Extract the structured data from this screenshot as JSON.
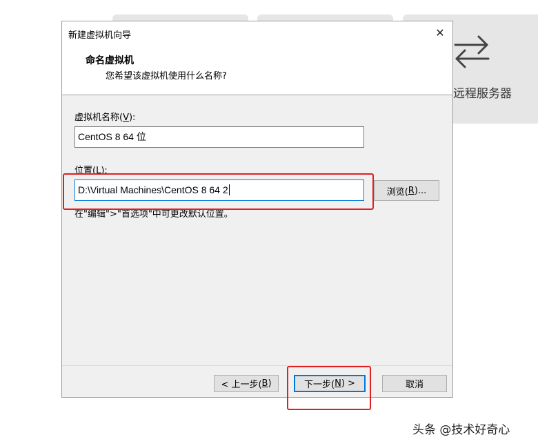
{
  "background": {
    "remote_label": "远程服务器"
  },
  "dialog": {
    "title": "新建虚拟机向导",
    "close_symbol": "✕",
    "heading": "命名虚拟机",
    "subheading": "您希望该虚拟机使用什么名称?",
    "name_label_prefix": "虚拟机名称(",
    "name_label_key": "V",
    "name_label_suffix": "):",
    "name_value": "CentOS 8 64 位",
    "location_label_prefix": "位置(",
    "location_label_key": "L",
    "location_label_suffix": "):",
    "location_value": "D:\\Virtual Machines\\CentOS 8 64 2",
    "browse_prefix": "浏览(",
    "browse_key": "R",
    "browse_suffix": ")...",
    "hint": "在\"编辑\">\"首选项\"中可更改默认位置。",
    "back_prefix": "< 上一步(",
    "back_key": "B",
    "back_suffix": ")",
    "next_prefix": "下一步(",
    "next_key": "N",
    "next_suffix": ") >",
    "cancel_label": "取消"
  },
  "watermark": "头条 @技术好奇心",
  "colors": {
    "highlight": "#e02020",
    "focus_border": "#0078d7"
  }
}
